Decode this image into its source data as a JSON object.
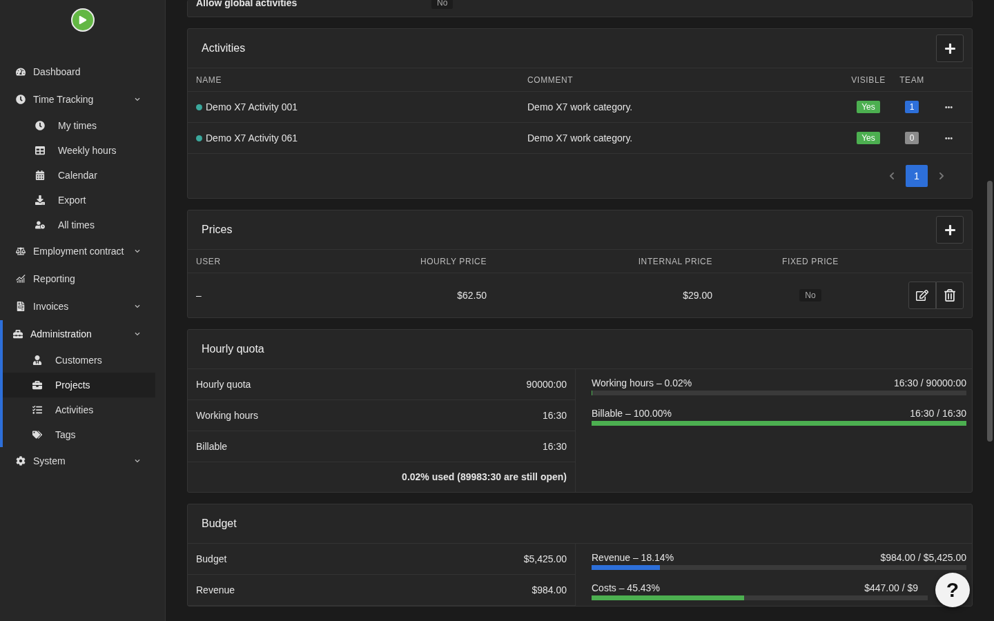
{
  "sidebar": {
    "items": [
      {
        "label": "Dashboard",
        "selected": false,
        "kind": "link"
      },
      {
        "label": "Time Tracking",
        "selected": false,
        "kind": "group",
        "children": [
          {
            "label": "My times",
            "selected": false
          },
          {
            "label": "Weekly hours",
            "selected": false
          },
          {
            "label": "Calendar",
            "selected": false
          },
          {
            "label": "Export",
            "selected": false
          },
          {
            "label": "All times",
            "selected": false
          }
        ]
      },
      {
        "label": "Employment contract",
        "selected": false,
        "kind": "group"
      },
      {
        "label": "Reporting",
        "selected": false,
        "kind": "link"
      },
      {
        "label": "Invoices",
        "selected": false,
        "kind": "group"
      },
      {
        "label": "Administration",
        "selected": true,
        "kind": "group",
        "children": [
          {
            "label": "Customers",
            "selected": false
          },
          {
            "label": "Projects",
            "selected": true
          },
          {
            "label": "Activities",
            "selected": false
          },
          {
            "label": "Tags",
            "selected": false
          }
        ]
      },
      {
        "label": "System",
        "selected": false,
        "kind": "group"
      }
    ]
  },
  "settings": {
    "label": "Allow global activities",
    "value": "No"
  },
  "activities": {
    "title": "Activities",
    "columns": [
      "NAME",
      "COMMENT",
      "VISIBLE",
      "TEAM"
    ],
    "rows": [
      {
        "name": "Demo X7 Activity 001",
        "color": "#3ba89c",
        "comment": "Demo X7 work category.",
        "visible": "Yes",
        "team": {
          "count": "1",
          "color": "#2d6fd9"
        }
      },
      {
        "name": "Demo X7 Activity 061",
        "color": "#3ba89c",
        "comment": "Demo X7 work category.",
        "visible": "Yes",
        "team": {
          "count": "0",
          "color": "#8c8c8c"
        }
      }
    ],
    "pages": [
      {
        "label": "1",
        "selected": true
      }
    ]
  },
  "prices": {
    "title": "Prices",
    "columns": [
      "USER",
      "HOURLY PRICE",
      "INTERNAL PRICE",
      "FIXED PRICE"
    ],
    "rows": [
      {
        "user": "–",
        "hourly": "$62.50",
        "internal": "$29.00",
        "fixed": "No"
      }
    ]
  },
  "hourly_quota": {
    "title": "Hourly quota",
    "rows": [
      {
        "label": "Hourly quota",
        "value": "90000:00"
      },
      {
        "label": "Working hours",
        "value": "16:30"
      },
      {
        "label": "Billable",
        "value": "16:30"
      }
    ],
    "summary": "0.02% used (89983:30 are still open)",
    "bars": [
      {
        "label": "Working hours – 0.02%",
        "reading": "16:30 / 90000:00",
        "level": 0.0002,
        "color": "#4caf50"
      },
      {
        "label": "Billable – 100.00%",
        "reading": "16:30 / 16:30",
        "level": 1,
        "color": "#4caf50"
      }
    ]
  },
  "budget": {
    "title": "Budget",
    "rows": [
      {
        "label": "Budget",
        "value": "$5,425.00"
      },
      {
        "label": "Revenue",
        "value": "$984.00"
      }
    ],
    "bars": [
      {
        "label": "Revenue – 18.14%",
        "reading": "$984.00 / $5,425.00",
        "level": 0.1814,
        "color": "#2d6fd9"
      },
      {
        "label": "Costs – 45.43%",
        "reading": "$447.00 / $9",
        "level": 0.4543,
        "color": "#4caf50"
      }
    ]
  },
  "help": "?"
}
